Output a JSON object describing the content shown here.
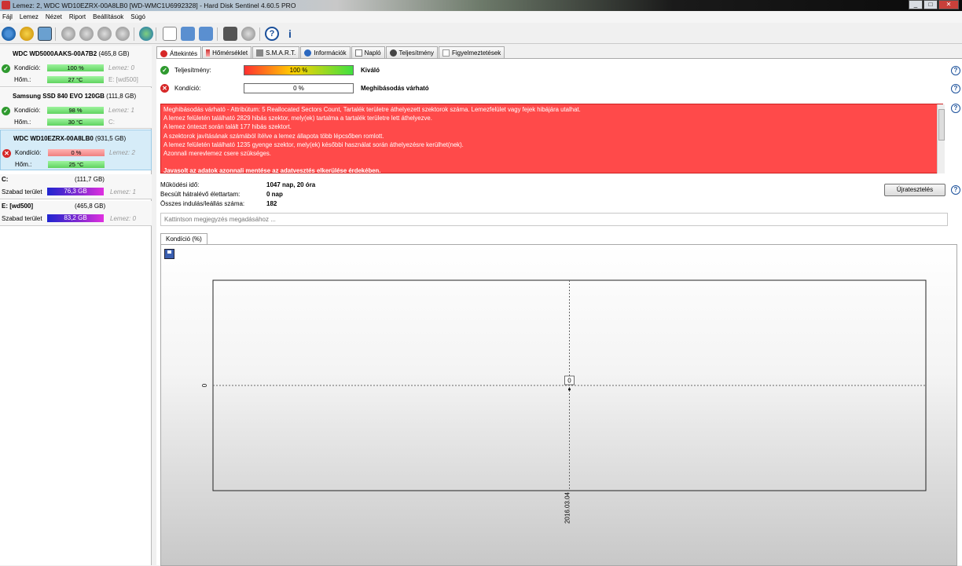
{
  "window": {
    "title": "Lemez: 2, WDC WD10EZRX-00A8LB0 [WD-WMC1U6992328] - Hard Disk Sentinel 4.60.5 PRO",
    "minimize": "_",
    "maximize": "□",
    "close": "✕"
  },
  "menu": [
    "Fájl",
    "Lemez",
    "Nézet",
    "Riport",
    "Beállítások",
    "Súgó"
  ],
  "toolbar_icons": [
    "refresh-icon",
    "alert-icon",
    "screen-icon",
    "disk-gray-icon",
    "disk-gray-icon",
    "disk-gray-icon",
    "disk-gray-icon",
    "globe-icon",
    "document-icon",
    "sync-icon",
    "network-icon",
    "report-icon",
    "disk-dark-icon",
    "help-icon",
    "info-icon"
  ],
  "disks": [
    {
      "name": "WDC WD5000AAKS-00A7B2",
      "size": "(465,8 GB)",
      "health_label": "Kondíció:",
      "health": "100 %",
      "health_value": 100,
      "temp_label": "Hőm.:",
      "temp": "27 °C",
      "side1": "Lemez: 0",
      "side2": "E: [wd500]",
      "status": "ok"
    },
    {
      "name": "Samsung SSD 840 EVO 120GB",
      "size": "(111,8 GB)",
      "health_label": "Kondíció:",
      "health": "98 %",
      "health_value": 98,
      "temp_label": "Hőm.:",
      "temp": "30 °C",
      "side1": "Lemez: 1",
      "side2": "C:",
      "status": "ok"
    },
    {
      "name": "WDC WD10EZRX-00A8LB0",
      "size": "(931,5 GB)",
      "health_label": "Kondíció:",
      "health": "0 %",
      "health_value": 0,
      "temp_label": "Hőm.:",
      "temp": "25 °C",
      "side1": "Lemez: 2",
      "side2": "",
      "status": "bad"
    }
  ],
  "volumes": [
    {
      "name": "C:",
      "size": "(111,7 GB)",
      "free_label": "Szabad terület",
      "free": "76,3 GB",
      "side": "Lemez: 1"
    },
    {
      "name": "E: [wd500]",
      "size": "(465,8 GB)",
      "free_label": "Szabad terület",
      "free": "83,2 GB",
      "side": "Lemez: 0"
    }
  ],
  "tabs": [
    "Áttekintés",
    "Hőmérséklet",
    "S.M.A.R.T.",
    "Információk",
    "Napló",
    "Teljesítmény",
    "Figyelmeztetések"
  ],
  "overview": {
    "perf_label": "Teljesítmény:",
    "perf_value": "100 %",
    "perf_verdict": "Kiváló",
    "cond_label": "Kondíció:",
    "cond_value": "0 %",
    "cond_verdict": "Meghibásodás várható",
    "alert_lines": [
      "Meghibásodás várható - Attribútum: 5 Reallocated Sectors Count, Tartalék területre áthelyezett szektorok száma. Lemezfelület vagy fejek hibájára utalhat.",
      "A lemez felületén található 2829 hibás szektor, mely(ek) tartalma a tartalék területre lett áthelyezve.",
      "A lemez önteszt során talált 177 hibás szektort.",
      "A szektorok javításának számából ítélve a lemez állapota több lépcsőben romlott.",
      "A lemez felületén található 1235 gyenge szektor, mely(ek) későbbi használat során áthelyezésre kerülhet(nek).",
      "Azonnali merevlemez csere szükséges."
    ],
    "alert_strong": "Javasolt az adatok azonnali mentése az adatvesztés elkerülése érdekében.",
    "uptime_label": "Működési idő:",
    "uptime": "1047 nap, 20 óra",
    "remaining_label": "Becsült hátralévő élettartam:",
    "remaining": "0 nap",
    "starts_label": "Összes indulás/leállás száma:",
    "starts": "182",
    "retest_button": "Újratesztelés",
    "note_placeholder": "Kattintson megjegyzés megadásához ...",
    "help": "?"
  },
  "chart_tab": "Kondíció  (%)",
  "chart_data": {
    "type": "line",
    "title": "",
    "x": [
      "2016.03.04"
    ],
    "series": [
      {
        "values": [
          0
        ]
      }
    ],
    "ytick_labels": [
      "0"
    ],
    "data_label": "0",
    "xlabel": "",
    "ylabel": "",
    "grid": "dashed crosshair"
  }
}
